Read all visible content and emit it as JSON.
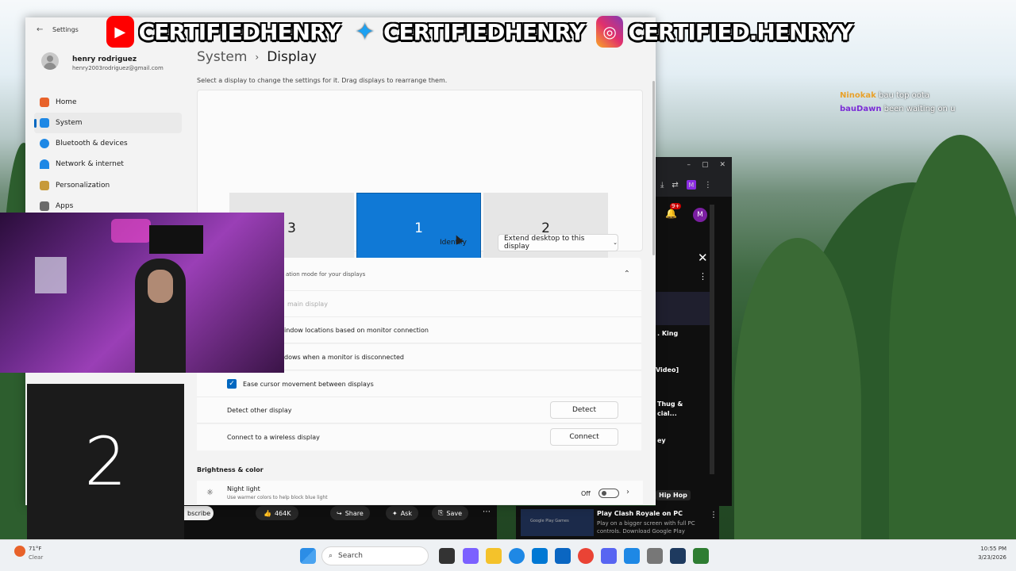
{
  "banner": {
    "handle1": "CERTIFIEDHENRY",
    "handle2": "CERTIFIEDHENRY",
    "handle3": "CERTIFIED.HENRYY",
    "youtube_color": "#ff0000",
    "twitter_color": "#1da1f2",
    "instagram_color": "#d6249f"
  },
  "chat": [
    {
      "user": "Ninokak",
      "msg": "bau top oota",
      "color": "#e8a12b"
    },
    {
      "user": "bauDawn",
      "msg": "been waiting on u",
      "color": "#7b2cd6"
    }
  ],
  "settings": {
    "app_title": "Settings",
    "user": {
      "name": "henry rodriguez",
      "email": "henry2003rodriguez@gmail.com"
    },
    "nav": [
      {
        "label": "Home",
        "icon": "home-icon",
        "color": "#e8622a"
      },
      {
        "label": "System",
        "icon": "system-icon",
        "color": "#1e88e5"
      },
      {
        "label": "Bluetooth & devices",
        "icon": "bluetooth-icon",
        "color": "#1e88e5"
      },
      {
        "label": "Network & internet",
        "icon": "wifi-icon",
        "color": "#1e88e5"
      },
      {
        "label": "Personalization",
        "icon": "brush-icon",
        "color": "#c79a3a"
      },
      {
        "label": "Apps",
        "icon": "apps-icon",
        "color": "#6b6b6b"
      }
    ],
    "breadcrumb": {
      "parent": "System",
      "sep": "›",
      "current": "Display"
    },
    "intro": "Select a display to change the settings for it. Drag displays to rearrange them.",
    "monitors": [
      "3",
      "1",
      "2"
    ],
    "identify": "Identify",
    "extend": "Extend desktop to this display",
    "multi": {
      "desc": "ation mode for your displays",
      "main": "main display",
      "rows": [
        "indow locations based on monitor connection",
        "dows when a monitor is disconnected"
      ],
      "ease": "Ease cursor movement between displays"
    },
    "detect": {
      "label": "Detect other display",
      "button": "Detect"
    },
    "wireless": {
      "label": "Connect to a wireless display",
      "button": "Connect"
    },
    "brightness_header": "Brightness & color",
    "night": {
      "label": "Night light",
      "sub": "Use warmer colors to help block blue light",
      "state": "Off"
    }
  },
  "identify_overlay": "2",
  "browser": {
    "items": [
      ". King",
      "Video]",
      "Thug &",
      "cial...",
      "ey",
      "Hip Hop"
    ],
    "badge": "9+",
    "avatar": "M"
  },
  "youtube_bar": {
    "subscribe": "bscribe",
    "likes": "464K",
    "share": "Share",
    "ask": "Ask",
    "save": "Save"
  },
  "ad": {
    "brand": "Google Play Games",
    "title": "Play Clash Royale on PC",
    "body": "Play on a bigger screen with full PC controls. Download Google Play"
  },
  "taskbar": {
    "temp": "71°F",
    "weather": "Clear",
    "search": "Search",
    "time": "10:55 PM",
    "date": "3/23/2026"
  }
}
